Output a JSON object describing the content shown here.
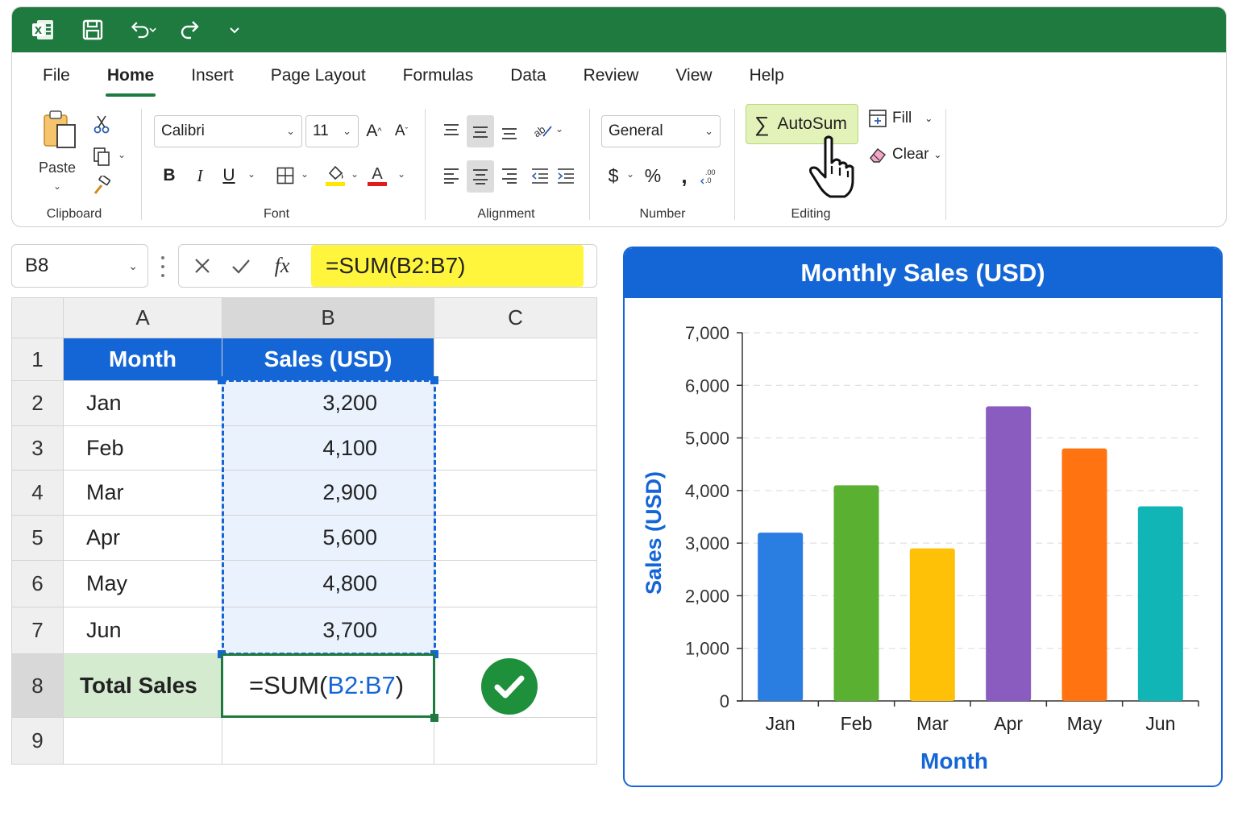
{
  "app": {
    "name": "Excel",
    "brand_color": "#1e7a3e",
    "quick_access": [
      {
        "name": "excel-logo-icon"
      },
      {
        "name": "save-icon"
      },
      {
        "name": "undo-icon"
      },
      {
        "name": "redo-icon"
      },
      {
        "name": "customize-quick-access-icon"
      }
    ]
  },
  "tabs": [
    {
      "label": "File",
      "active": false
    },
    {
      "label": "Home",
      "active": true
    },
    {
      "label": "Insert",
      "active": false
    },
    {
      "label": "Page Layout",
      "active": false
    },
    {
      "label": "Formulas",
      "active": false
    },
    {
      "label": "Data",
      "active": false
    },
    {
      "label": "Review",
      "active": false
    },
    {
      "label": "View",
      "active": false
    },
    {
      "label": "Help",
      "active": false
    }
  ],
  "ribbon": {
    "clipboard": {
      "group_label": "Clipboard",
      "paste_label": "Paste"
    },
    "font": {
      "group_label": "Font",
      "font_name": "Calibri",
      "font_size": "11",
      "bold": "B",
      "italic": "I",
      "underline": "U"
    },
    "alignment": {
      "group_label": "Alignment"
    },
    "number": {
      "group_label": "Number",
      "format": "General",
      "currency": "$",
      "percent": "%"
    },
    "editing": {
      "group_label": "Editing",
      "autosum_label": "AutoSum",
      "fill_label": "Fill",
      "clear_label": "Clear"
    }
  },
  "formula_bar": {
    "name_box": "B8",
    "fx": "fx",
    "formula": "=SUM(B2:B7)",
    "highlight_color": "#fff53d"
  },
  "sheet": {
    "columns": [
      "A",
      "B",
      "C"
    ],
    "row_numbers": [
      "1",
      "2",
      "3",
      "4",
      "5",
      "6",
      "7",
      "8",
      "9"
    ],
    "headers": {
      "month": "Month",
      "sales": "Sales (USD)"
    },
    "rows": [
      {
        "month": "Jan",
        "sales": "3,200"
      },
      {
        "month": "Feb",
        "sales": "4,100"
      },
      {
        "month": "Mar",
        "sales": "2,900"
      },
      {
        "month": "Apr",
        "sales": "5,600"
      },
      {
        "month": "May",
        "sales": "4,800"
      },
      {
        "month": "Jun",
        "sales": "3,700"
      }
    ],
    "total_label": "Total Sales",
    "total_formula_prefix": "=SUM(",
    "total_formula_ref": "B2:B7",
    "total_formula_suffix": ")"
  },
  "chart_data": {
    "type": "bar",
    "title": "Monthly Sales (USD)",
    "xlabel": "Month",
    "ylabel": "Sales (USD)",
    "categories": [
      "Jan",
      "Feb",
      "Mar",
      "Apr",
      "May",
      "Jun"
    ],
    "values": [
      3200,
      4100,
      2900,
      5600,
      4800,
      3700
    ],
    "colors": [
      "#2a7de1",
      "#5ab031",
      "#ffc107",
      "#8b5cc0",
      "#ff7411",
      "#12b5b5"
    ],
    "ylim": [
      0,
      7000
    ],
    "yticks": [
      0,
      1000,
      2000,
      3000,
      4000,
      5000,
      6000,
      7000
    ],
    "ytick_labels": [
      "0",
      "1,000",
      "2,000",
      "3,000",
      "4,000",
      "5,000",
      "6,000",
      "7,000"
    ],
    "grid": true,
    "accent_color": "#1466d6"
  }
}
